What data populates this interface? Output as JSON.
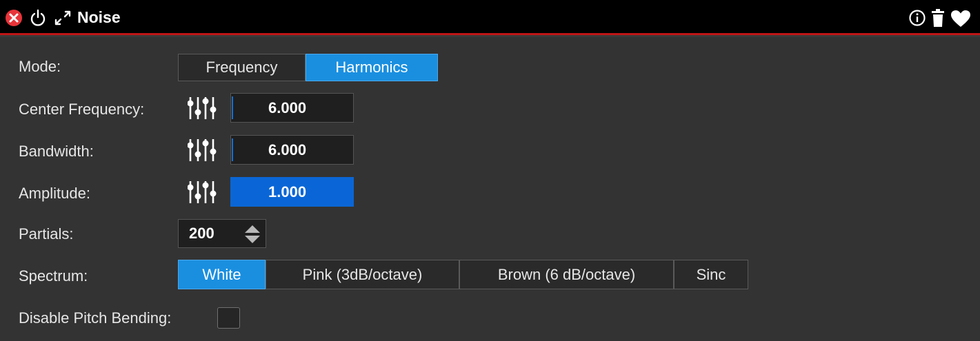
{
  "window": {
    "title": "Noise",
    "icons": [
      "close-icon",
      "power-icon",
      "expand-icon",
      "info-icon",
      "trash-icon",
      "heart-icon"
    ],
    "title_bar_color": "#000000",
    "title_bar_border_color": "#c01515",
    "accent_color": "#1a8fe0"
  },
  "mode": {
    "label": "Mode:",
    "options": [
      "Frequency",
      "Harmonics"
    ],
    "selected": "Harmonics"
  },
  "center_frequency": {
    "label": "Center Frequency:",
    "value": "6.000"
  },
  "bandwidth": {
    "label": "Bandwidth:",
    "value": "6.000"
  },
  "amplitude": {
    "label": "Amplitude:",
    "value": "1.000"
  },
  "partials": {
    "label": "Partials:",
    "value": "200"
  },
  "spectrum": {
    "label": "Spectrum:",
    "options": [
      "White",
      "Pink (3dB/octave)",
      "Brown (6 dB/octave)",
      "Sinc"
    ],
    "selected": "White"
  },
  "disable_pitch_bending": {
    "label": "Disable Pitch Bending:",
    "checked": false
  }
}
